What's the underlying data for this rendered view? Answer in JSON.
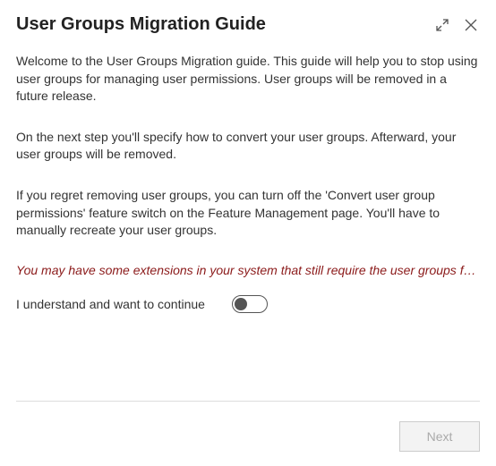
{
  "header": {
    "title": "User Groups Migration Guide"
  },
  "body": {
    "p1": "Welcome to the User Groups Migration guide. This guide will help you to stop using user groups for managing user permissions. User groups will be removed in a future release.",
    "p2": "On the next step you'll specify how to convert your user groups. Afterward, your user groups will be removed.",
    "p3": "If you regret removing user groups, you can turn off the 'Convert user group permissions' feature switch on the Feature Management page. You'll have to manually recreate your user groups.",
    "warning": "You may have some extensions in your system that still require the user groups functionality.",
    "toggle_label": "I understand and want to continue",
    "toggle_state": "off"
  },
  "footer": {
    "next_label": "Next"
  }
}
